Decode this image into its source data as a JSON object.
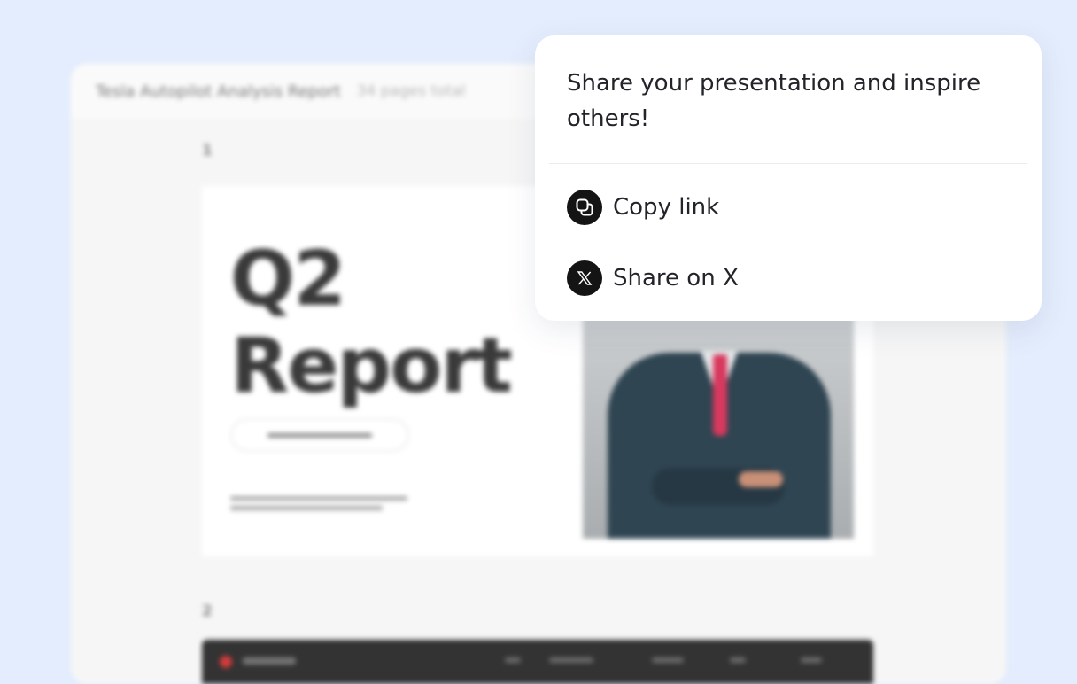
{
  "background_window": {
    "title": "Tesla Autopilot Analysis Report",
    "page_count": "34 pages total",
    "slides": [
      {
        "number": "1",
        "title": "Q2\nReport"
      },
      {
        "number": "2"
      }
    ]
  },
  "share_popover": {
    "heading": "Share your presentation and inspire others!",
    "options": [
      {
        "label": "Copy link",
        "icon": "copy-icon"
      },
      {
        "label": "Share on X",
        "icon": "x-logo-icon"
      }
    ]
  },
  "colors": {
    "page_background": "#e4edfd",
    "popover_background": "#ffffff",
    "icon_circle": "#141414",
    "text_primary": "#23242a"
  }
}
